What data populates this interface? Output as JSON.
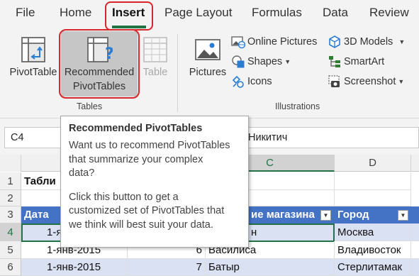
{
  "tabs": [
    {
      "label": "File",
      "active": false
    },
    {
      "label": "Home",
      "active": false
    },
    {
      "label": "Insert",
      "active": true
    },
    {
      "label": "Page Layout",
      "active": false
    },
    {
      "label": "Formulas",
      "active": false
    },
    {
      "label": "Data",
      "active": false
    },
    {
      "label": "Review",
      "active": false
    }
  ],
  "ribbon": {
    "tables": {
      "group_label": "Tables",
      "pivot_table": "PivotTable",
      "recommended_line1": "Recommended",
      "recommended_line2": "PivotTables",
      "table": "Table"
    },
    "illustrations": {
      "group_label": "Illustrations",
      "pictures": "Pictures",
      "online_pictures": "Online Pictures",
      "shapes": "Shapes",
      "icons": "Icons",
      "models_3d": "3D Models",
      "smartart": "SmartArt",
      "screenshot": "Screenshot"
    }
  },
  "formula_bar": {
    "name_box": "C4",
    "visible_value": "Никитич"
  },
  "tooltip": {
    "title": "Recommended PivotTables",
    "paragraph1": "Want us to recommend PivotTables\nthat summarize your complex\ndata?",
    "paragraph2": "Click this button to get a\ncustomized set of PivotTables that\nwe think will best suit your data."
  },
  "grid": {
    "columns": [
      "C",
      "D"
    ],
    "rows": [
      "1",
      "2",
      "3",
      "4",
      "5",
      "6"
    ],
    "title_cell": "Табли",
    "headers": {
      "date": "Дата",
      "store": "ие магазина",
      "city": "Город"
    },
    "data": [
      {
        "date": "1-янв",
        "num": "",
        "store": "н",
        "city": "Москва"
      },
      {
        "date": "1-янв-2015",
        "num": "6",
        "store": "Василиса",
        "city": "Владивосток"
      },
      {
        "date": "1-янв-2015",
        "num": "7",
        "store": "Батыр",
        "city": "Стерлитамак"
      }
    ]
  },
  "colors": {
    "accent": "#217346",
    "highlight": "#d9262b",
    "table_header": "#4472c4",
    "table_band": "#d9e1f2"
  },
  "icons": [
    "pivot-table-icon",
    "recommended-pivot-icon",
    "table-icon",
    "pictures-icon",
    "online-pictures-icon",
    "shapes-icon",
    "icons-icon",
    "3d-models-icon",
    "smartart-icon",
    "screenshot-icon",
    "filter-dropdown-icon"
  ]
}
